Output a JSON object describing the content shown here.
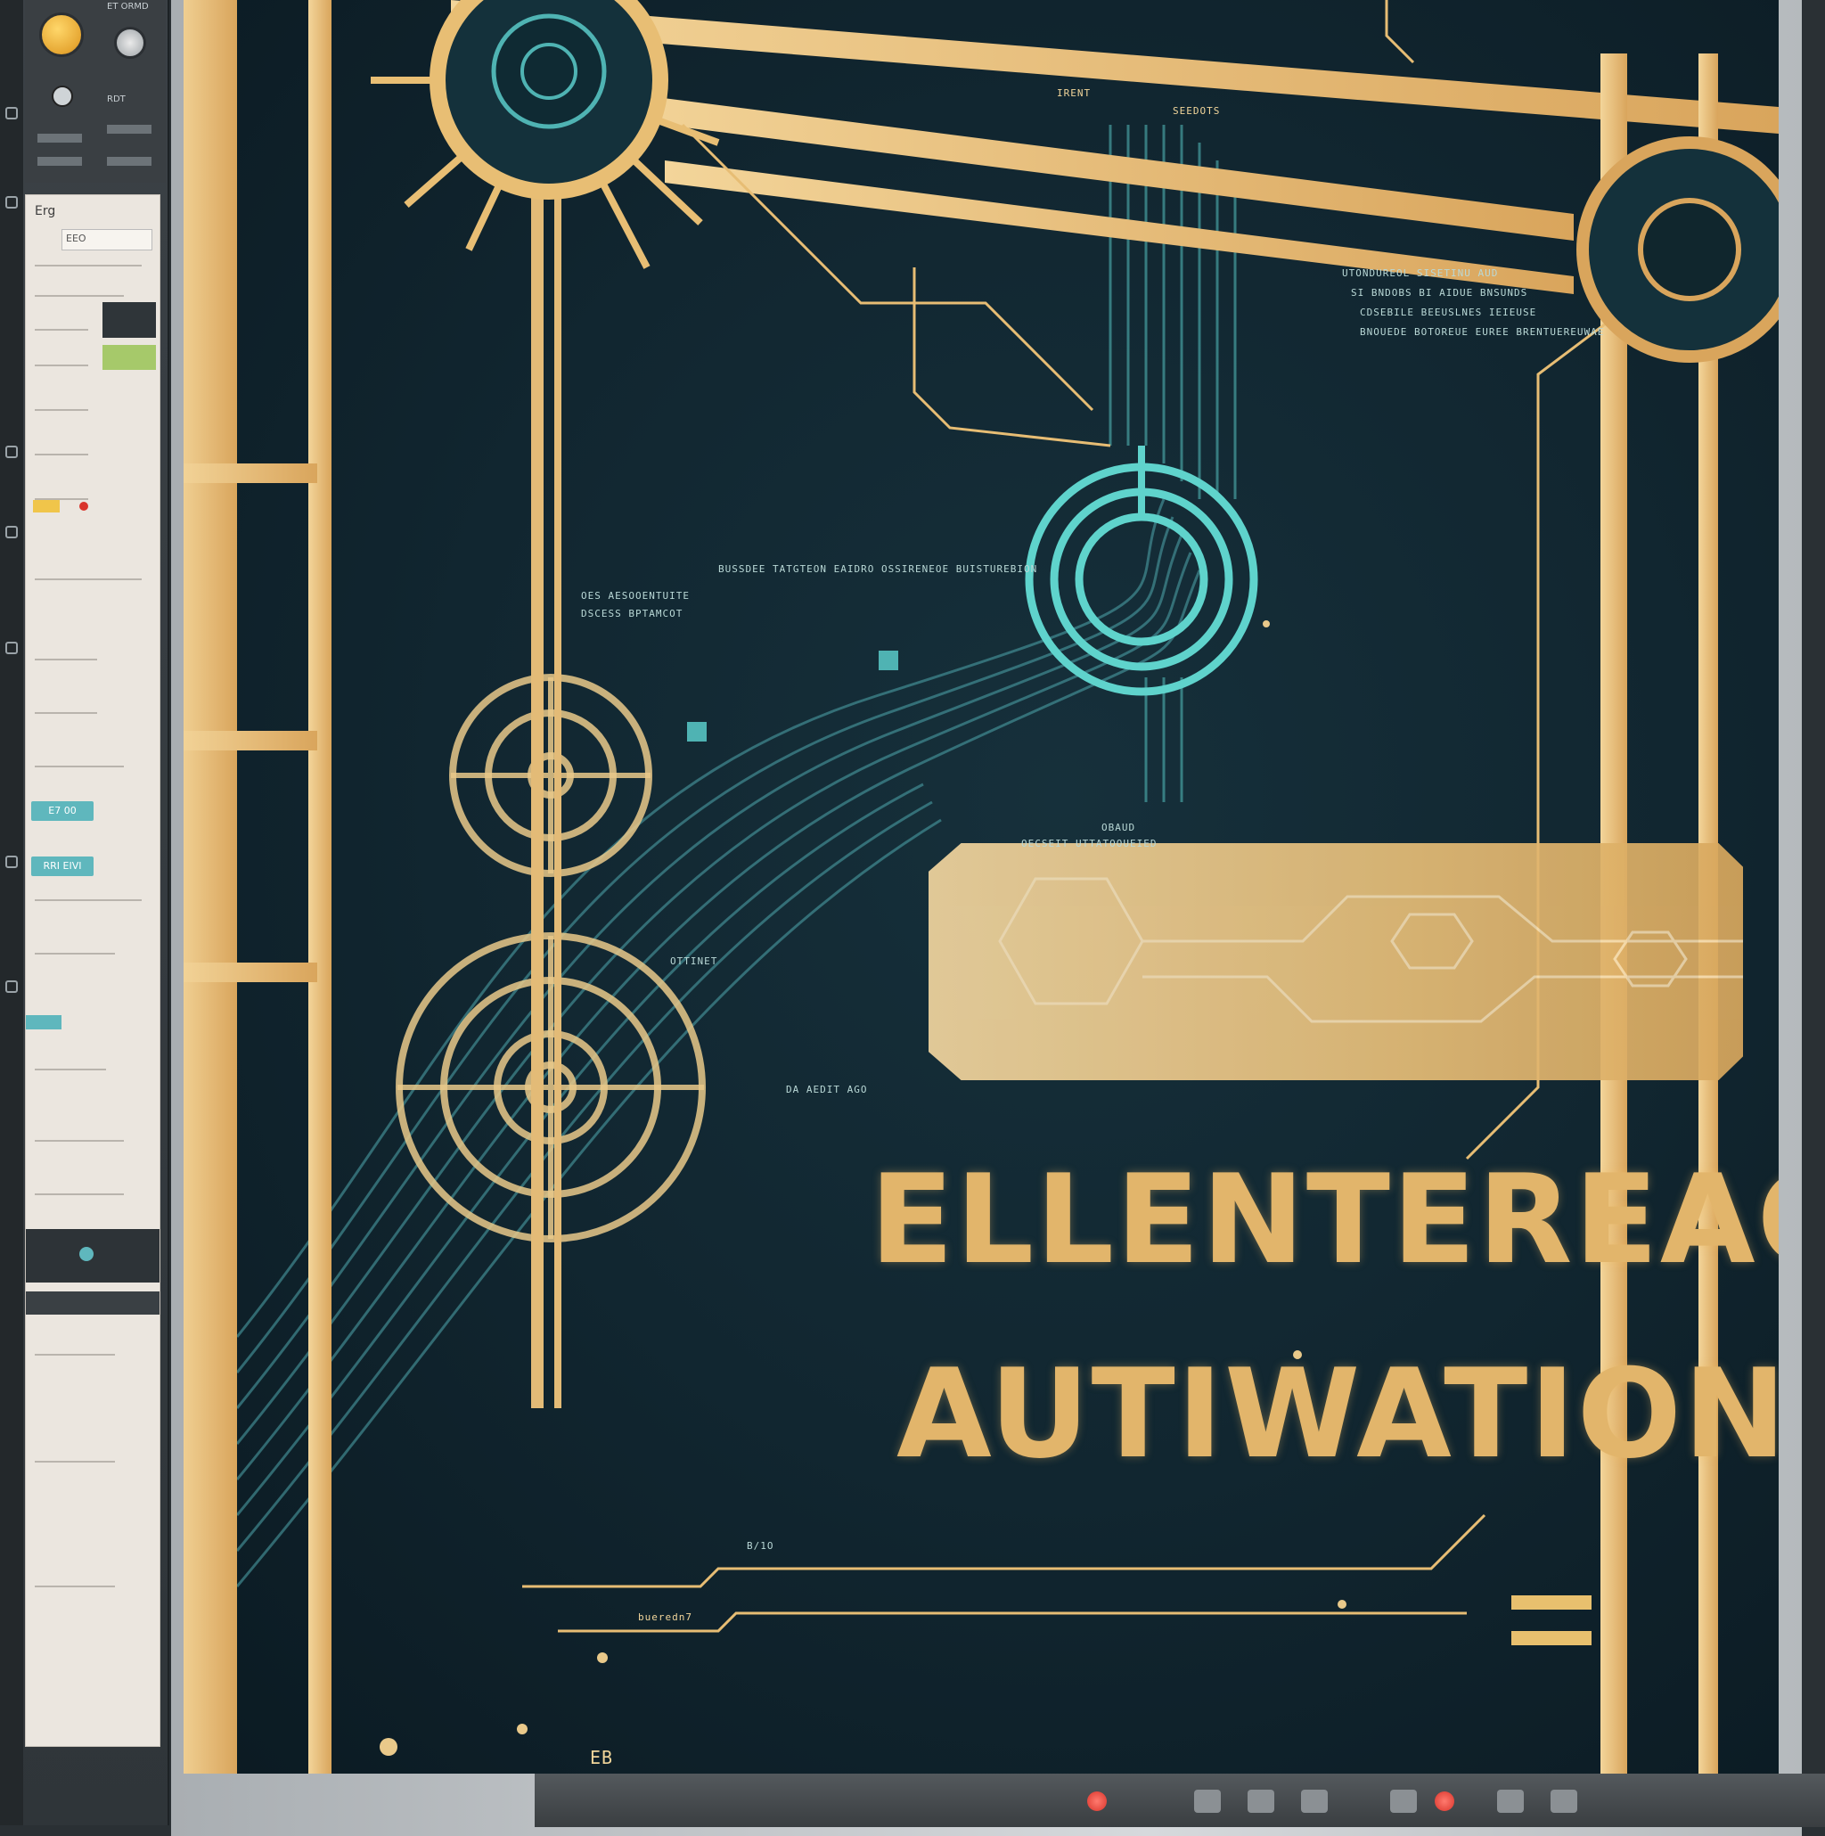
{
  "sidebar": {
    "top_label_a": "ET ORMD",
    "top_label_b": "RDT",
    "panel_title": "Erg",
    "panel_field": "EEO",
    "chip_1": "E7 00",
    "chip_2": "RRI EIVI"
  },
  "screen": {
    "header_label_1": "IRENT",
    "header_label_2": "SEEDOTS",
    "info_line_1": "UTONDUREOL SISETINU AUD",
    "info_line_2": "SI BNDOBS BI AIDUE BNSUNDS",
    "info_line_3": "CDSEBILE BEEUSLNES IEIEUSE",
    "info_line_4": "BNOUEDE BOTOREUE EUREE BRENTUEREUWAE",
    "arc_label_1": "OES AESOOENTUITE",
    "arc_label_2": "DSCESS BPTAMCOT",
    "arc_label_3": "BUSSDEE TATGTEON EAIDRO OSSIRENEOE BUISTUREBION",
    "small_label_1": "OBAUD",
    "small_label_2": "OECSEIT UTTATOOUEIED",
    "small_label_3": "OTTINET",
    "small_label_4": "DA AEDIT AGO",
    "small_label_5": "bueredn7",
    "small_label_6": "B/1O",
    "small_label_7": "EB",
    "headline_line_1": "ELLENTEREAO",
    "headline_line_2": "AUTIWATION"
  },
  "colors": {
    "gold": "#e2b56b",
    "teal": "#5fd3cc",
    "screen_bg": "#112630"
  }
}
